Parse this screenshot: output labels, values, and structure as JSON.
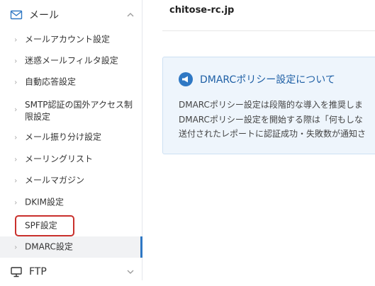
{
  "sidebar": {
    "mail_section": {
      "label": "メール"
    },
    "items": [
      {
        "label": "メールアカウント設定"
      },
      {
        "label": "迷惑メールフィルタ設定"
      },
      {
        "label": "自動応答設定"
      },
      {
        "label": "SMTP認証の国外アクセス制限設定"
      },
      {
        "label": "メール振り分け設定"
      },
      {
        "label": "メーリングリスト"
      },
      {
        "label": "メールマガジン"
      },
      {
        "label": "DKIM設定"
      },
      {
        "label": "SPF設定"
      },
      {
        "label": "DMARC設定"
      }
    ],
    "ftp_section": {
      "label": "FTP"
    }
  },
  "main": {
    "domain": "chitose-rc.jp",
    "info": {
      "title": "DMARCポリシー設定について",
      "lines": [
        "DMARCポリシー設定は段階的な導入を推奨しま",
        "DMARCポリシー設定を開始する際は「何もしな",
        "送付されたレポートに認証成功・失敗数が通知さ"
      ]
    }
  },
  "colors": {
    "accent": "#2f78c4",
    "highlight": "#c9302c",
    "info_bg": "#eef5fc"
  }
}
